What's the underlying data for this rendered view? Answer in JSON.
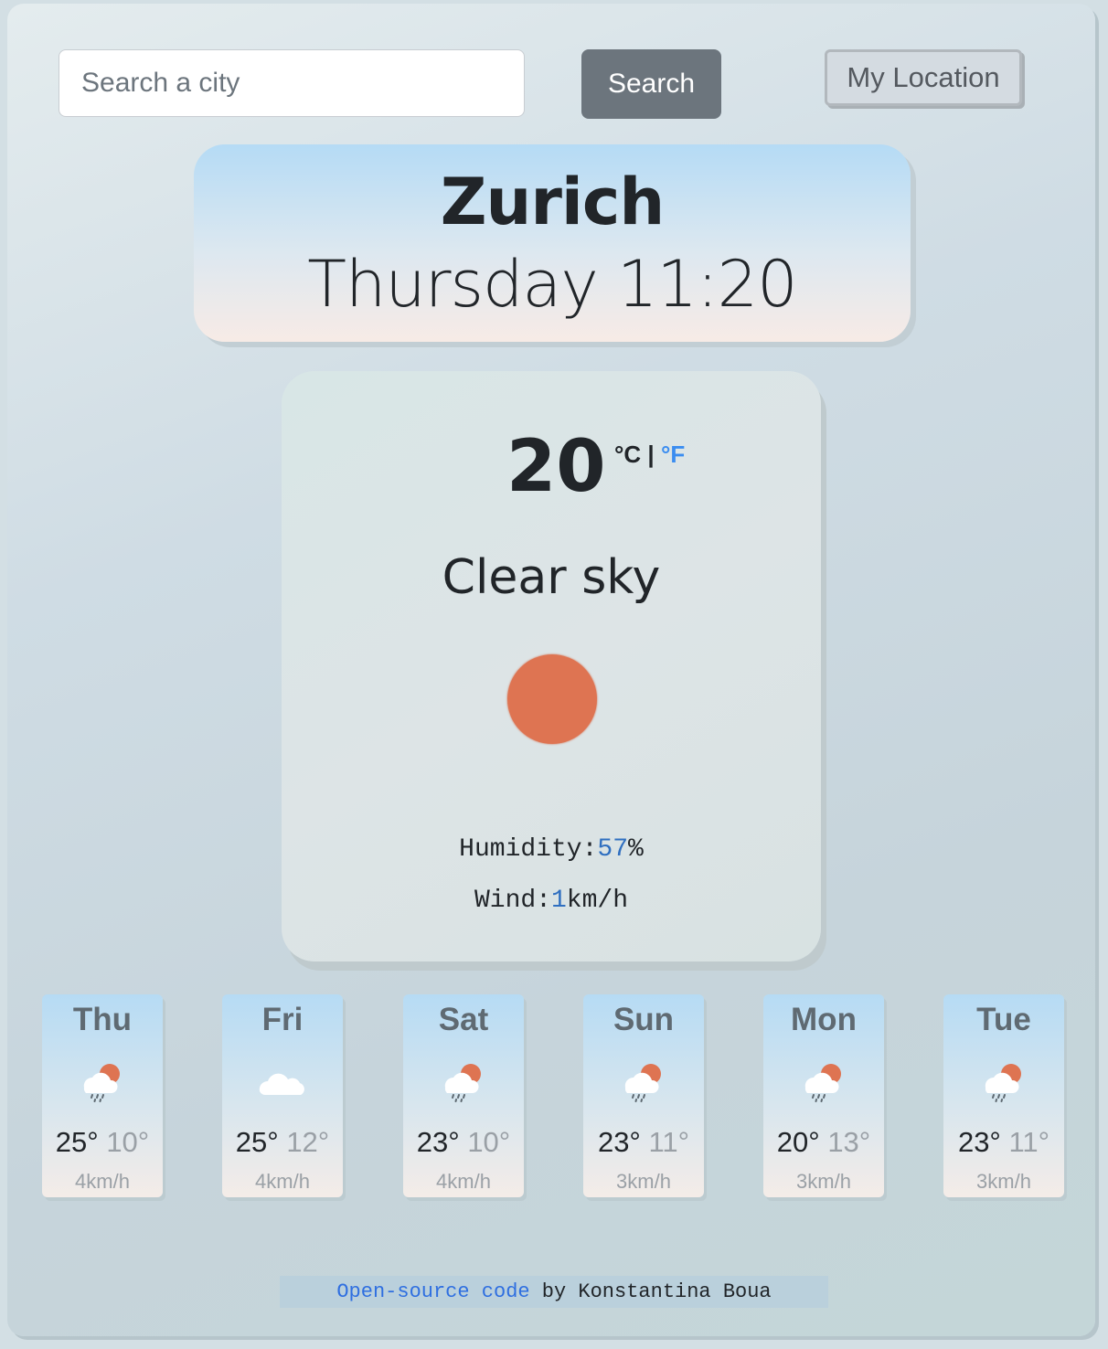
{
  "search": {
    "placeholder": "Search a city",
    "button_label": "Search",
    "location_label": "My Location"
  },
  "header": {
    "city": "Zurich",
    "day_time": "Thursday 11:20"
  },
  "current": {
    "temperature": "20",
    "unit_c": "°C",
    "unit_sep": "|",
    "unit_f": "°F",
    "description": "Clear sky",
    "icon": "sun-icon",
    "humidity_label": "Humidity:",
    "humidity_value": "57",
    "humidity_unit": "%",
    "wind_label": "Wind:",
    "wind_value": "1",
    "wind_unit": "km/h"
  },
  "forecast": [
    {
      "day": "Thu",
      "max": "25°",
      "min": "10°",
      "wind": "4km/h",
      "icon": "rain-sun-icon"
    },
    {
      "day": "Fri",
      "max": "25°",
      "min": "12°",
      "wind": "4km/h",
      "icon": "cloud-icon"
    },
    {
      "day": "Sat",
      "max": "23°",
      "min": "10°",
      "wind": "4km/h",
      "icon": "rain-sun-icon"
    },
    {
      "day": "Sun",
      "max": "23°",
      "min": "11°",
      "wind": "3km/h",
      "icon": "rain-sun-icon"
    },
    {
      "day": "Mon",
      "max": "20°",
      "min": "13°",
      "wind": "3km/h",
      "icon": "rain-sun-icon"
    },
    {
      "day": "Tue",
      "max": "23°",
      "min": "11°",
      "wind": "3km/h",
      "icon": "rain-sun-icon"
    }
  ],
  "footer": {
    "link_text": "Open-source code",
    "rest_text": " by Konstantina Boua"
  },
  "colors": {
    "accent_blue": "#3b8df0",
    "sun": "#de7452",
    "button_gray": "#6c757d"
  }
}
